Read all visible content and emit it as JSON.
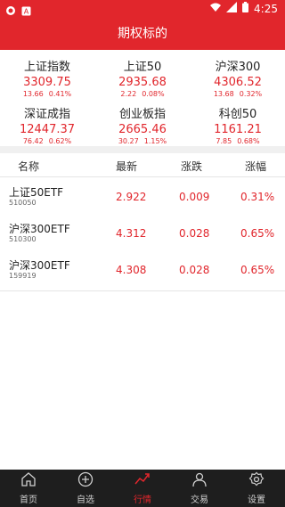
{
  "status": {
    "time": "4:25"
  },
  "header": {
    "title": "期权标的"
  },
  "indices": [
    {
      "name": "上证指数",
      "value": "3309.75",
      "chg": "13.66",
      "pct": "0.41%"
    },
    {
      "name": "上证50",
      "value": "2935.68",
      "chg": "2.22",
      "pct": "0.08%"
    },
    {
      "name": "沪深300",
      "value": "4306.52",
      "chg": "13.68",
      "pct": "0.32%"
    },
    {
      "name": "深证成指",
      "value": "12447.37",
      "chg": "76.42",
      "pct": "0.62%"
    },
    {
      "name": "创业板指",
      "value": "2665.46",
      "chg": "30.27",
      "pct": "1.15%"
    },
    {
      "name": "科创50",
      "value": "1161.21",
      "chg": "7.85",
      "pct": "0.68%"
    }
  ],
  "table": {
    "headers": {
      "name": "名称",
      "latest": "最新",
      "change": "涨跌",
      "pct": "涨幅"
    },
    "rows": [
      {
        "name": "上证50ETF",
        "code": "510050",
        "latest": "2.922",
        "change": "0.009",
        "pct": "0.31%"
      },
      {
        "name": "沪深300ETF",
        "code": "510300",
        "latest": "4.312",
        "change": "0.028",
        "pct": "0.65%"
      },
      {
        "name": "沪深300ETF",
        "code": "159919",
        "latest": "4.308",
        "change": "0.028",
        "pct": "0.65%"
      }
    ]
  },
  "nav": [
    {
      "label": "首页",
      "icon": "home-icon"
    },
    {
      "label": "自选",
      "icon": "plus-circle-icon"
    },
    {
      "label": "行情",
      "icon": "trend-icon",
      "active": true
    },
    {
      "label": "交易",
      "icon": "user-icon"
    },
    {
      "label": "设置",
      "icon": "gear-icon"
    }
  ],
  "colors": {
    "accent": "#e1262c",
    "navbg": "#1e1e1e"
  }
}
